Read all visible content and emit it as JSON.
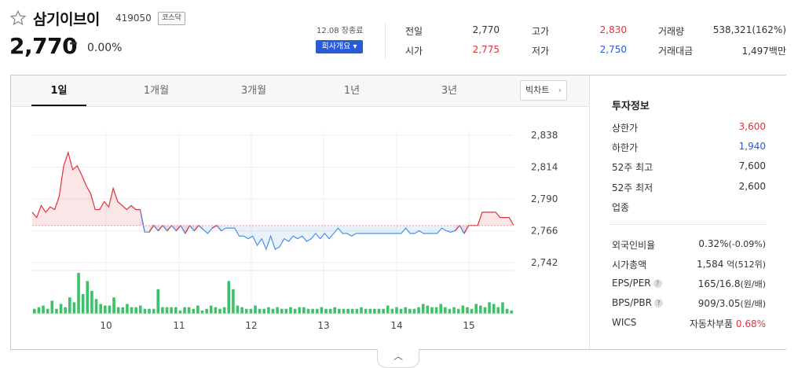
{
  "stock": {
    "name": "삼기이브이",
    "code": "419050",
    "market": "코스닥",
    "price": "2,770",
    "change_symbol": "–",
    "change_pct": "0.00%",
    "date_label": "12.08 장종료",
    "company_button": "회사개요 ▾"
  },
  "summary": {
    "prev_close_label": "전일",
    "prev_close": "2,770",
    "high_label": "고가",
    "high": "2,830",
    "volume_label": "거래량",
    "volume": "538,321(162%)",
    "open_label": "시가",
    "open": "2,775",
    "low_label": "저가",
    "low": "2,750",
    "trade_value_label": "거래대금",
    "trade_value": "1,497백만"
  },
  "tabs": [
    "1일",
    "1개월",
    "3개월",
    "1년",
    "3년"
  ],
  "active_tab": "1일",
  "bigchart_label": "빅차트",
  "colors": {
    "up": "#e0323c",
    "down": "#2a5bd7",
    "line_down": "#4a90e2",
    "volume": "#3cc269"
  },
  "chart_data": {
    "type": "line",
    "y_ticks": [
      "2,838",
      "2,814",
      "2,790",
      "2,766",
      "2,742"
    ],
    "y_tick_values": [
      2838,
      2814,
      2790,
      2766,
      2742
    ],
    "x_ticks": [
      "10",
      "11",
      "12",
      "13",
      "14",
      "15"
    ],
    "baseline": 2770,
    "price_series": [
      2780,
      2776,
      2785,
      2780,
      2784,
      2782,
      2792,
      2815,
      2825,
      2812,
      2815,
      2808,
      2800,
      2794,
      2782,
      2782,
      2788,
      2784,
      2798,
      2788,
      2785,
      2782,
      2785,
      2782,
      2782,
      2765,
      2765,
      2770,
      2766,
      2770,
      2766,
      2770,
      2766,
      2770,
      2764,
      2770,
      2766,
      2770,
      2767,
      2764,
      2768,
      2770,
      2766,
      2768,
      2768,
      2768,
      2762,
      2762,
      2760,
      2762,
      2755,
      2760,
      2752,
      2762,
      2752,
      2754,
      2760,
      2758,
      2762,
      2760,
      2762,
      2758,
      2760,
      2764,
      2760,
      2764,
      2760,
      2764,
      2768,
      2764,
      2764,
      2762,
      2764,
      2764,
      2764,
      2764,
      2764,
      2764,
      2764,
      2764,
      2764,
      2764,
      2764,
      2768,
      2764,
      2764,
      2766,
      2764,
      2764,
      2764,
      2764,
      2768,
      2766,
      2765,
      2766,
      2770,
      2764,
      2770,
      2770,
      2770,
      2780,
      2780,
      2780,
      2780,
      2776,
      2776,
      2776,
      2770
    ],
    "volume_series": [
      3,
      4,
      5,
      3,
      8,
      3,
      6,
      4,
      10,
      7,
      25,
      12,
      20,
      14,
      9,
      6,
      5,
      5,
      10,
      4,
      4,
      6,
      4,
      4,
      5,
      3,
      3,
      3,
      15,
      4,
      4,
      4,
      4,
      2,
      4,
      4,
      3,
      5,
      2,
      3,
      5,
      4,
      3,
      4,
      20,
      15,
      5,
      4,
      3,
      3,
      5,
      3,
      3,
      4,
      3,
      4,
      3,
      3,
      4,
      3,
      4,
      4,
      3,
      3,
      3,
      4,
      3,
      3,
      4,
      3,
      3,
      3,
      3,
      3,
      4,
      3,
      3,
      3,
      3,
      3,
      5,
      3,
      4,
      3,
      4,
      3,
      3,
      4,
      6,
      5,
      4,
      4,
      6,
      4,
      3,
      4,
      3,
      5,
      4,
      3,
      6,
      5,
      4,
      7,
      6,
      4,
      7,
      3,
      2
    ]
  },
  "invest": {
    "title": "투자정보",
    "rows1": [
      {
        "label": "상한가",
        "value": "3,600",
        "tone": "up"
      },
      {
        "label": "하한가",
        "value": "1,940",
        "tone": "down"
      },
      {
        "label": "52주 최고",
        "value": "7,600",
        "tone": ""
      },
      {
        "label": "52주 최저",
        "value": "2,600",
        "tone": ""
      },
      {
        "label": "업종",
        "value": "",
        "tone": ""
      }
    ],
    "foreign_label": "외국인비율",
    "foreign_pct": "0.32%",
    "foreign_change": "(-0.09%)",
    "mcap_label": "시가총액",
    "mcap_value": "1,584",
    "mcap_unit": "억(512위)",
    "eps_label": "EPS/PER",
    "eps_value": "165/16.8",
    "eps_unit": "(원/배)",
    "bps_label": "BPS/PBR",
    "bps_value": "909/3.05",
    "bps_unit": "(원/배)",
    "wics_label": "WICS",
    "wics_sector": "자동차부품",
    "wics_pct": "0.68%",
    "help_glyph": "?"
  }
}
